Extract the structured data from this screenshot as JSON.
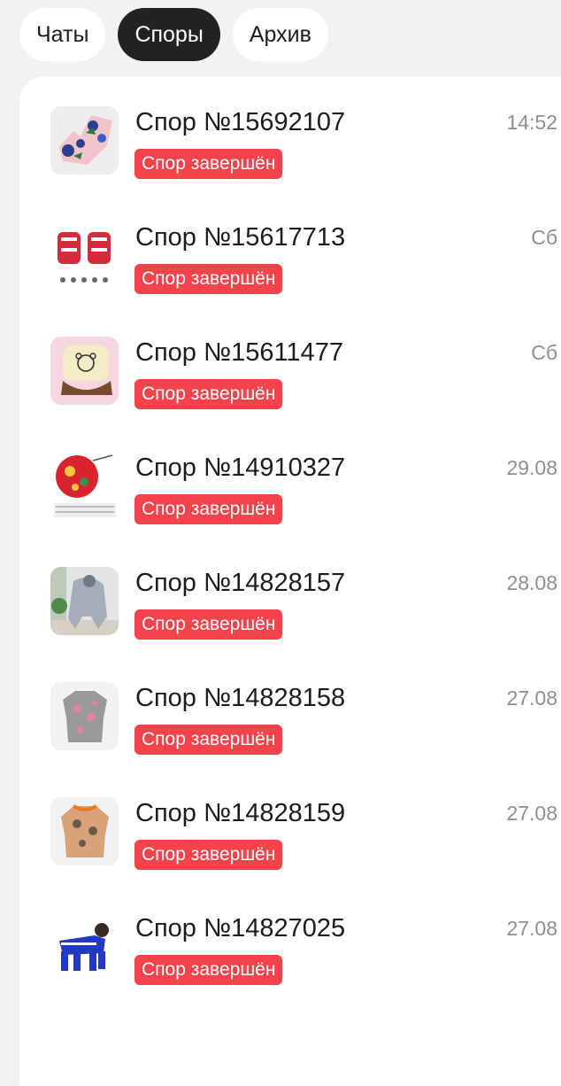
{
  "tabs": [
    {
      "label": "Чаты",
      "active": false
    },
    {
      "label": "Споры",
      "active": true
    },
    {
      "label": "Архив",
      "active": false
    }
  ],
  "disputes": [
    {
      "title": "Спор №15692107",
      "status": "Спор завершён",
      "time": "14:52",
      "thumb": "pink-floral-shirt"
    },
    {
      "title": "Спор №15617713",
      "status": "Спор завершён",
      "time": "Сб",
      "thumb": "red-christmas-pajamas"
    },
    {
      "title": "Спор №15611477",
      "status": "Спор завершён",
      "time": "Сб",
      "thumb": "bear-sweater-dress"
    },
    {
      "title": "Спор №14910327",
      "status": "Спор завершён",
      "time": "29.08",
      "thumb": "red-floral-shirt-size-chart"
    },
    {
      "title": "Спор №14828157",
      "status": "Спор завершён",
      "time": "28.08",
      "thumb": "grey-dog-jumpsuit"
    },
    {
      "title": "Спор №14828158",
      "status": "Спор завершён",
      "time": "27.08",
      "thumb": "grey-floral-tshirt"
    },
    {
      "title": "Спор №14828159",
      "status": "Спор завершён",
      "time": "27.08",
      "thumb": "orange-print-tshirt"
    },
    {
      "title": "Спор №14827025",
      "status": "Спор завершён",
      "time": "27.08",
      "thumb": "blue-dog-tracksuit"
    }
  ],
  "colors": {
    "badge": "#f5434b",
    "active_tab": "#222222",
    "background": "#f2f2f4"
  }
}
